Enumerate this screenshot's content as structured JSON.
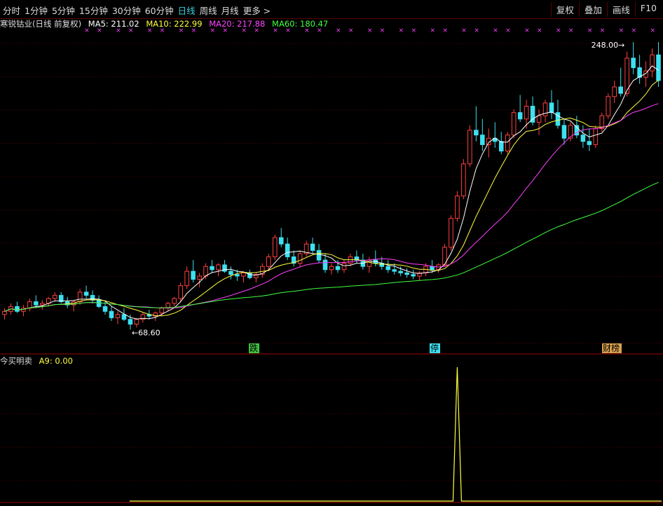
{
  "toolbar": {
    "periods": [
      "分时",
      "1分钟",
      "5分钟",
      "15分钟",
      "30分钟",
      "60分钟",
      "日线",
      "周线",
      "月线",
      "更多 >"
    ],
    "active_period": "日线",
    "right_buttons": [
      "复权",
      "叠加",
      "画线",
      "F10"
    ]
  },
  "info": {
    "stock_name": "寒锐钴业(日线 前复权)",
    "ma5_label": "MA5: 211.02",
    "ma10_label": "MA10: 222.99",
    "ma20_label": "MA20: 217.88",
    "ma60_label": "MA60: 180.47"
  },
  "colors": {
    "up": "#ff4040",
    "down": "#3ce0f0",
    "ma5": "#ffffff",
    "ma10": "#ffff40",
    "ma20": "#ff40ff",
    "ma60": "#40ff40",
    "grid": "#5a0000",
    "indicator": "#ffff40",
    "marker": "#ff40ff"
  },
  "annotations": {
    "high_label": "248.00",
    "low_label": "68.60",
    "event_1": "跌",
    "event_2": "停",
    "event_3": "财榜"
  },
  "indicator": {
    "name": "今买明卖",
    "value_label": "A9: 0.00"
  },
  "chart_data": {
    "type": "candlestick",
    "price_range": [
      60,
      255
    ],
    "candles": [
      [
        78,
        82,
        75,
        80
      ],
      [
        80,
        85,
        78,
        83
      ],
      [
        83,
        86,
        79,
        80
      ],
      [
        80,
        84,
        77,
        82
      ],
      [
        82,
        88,
        80,
        86
      ],
      [
        86,
        90,
        82,
        84
      ],
      [
        84,
        87,
        81,
        85
      ],
      [
        85,
        89,
        83,
        88
      ],
      [
        88,
        92,
        86,
        90
      ],
      [
        90,
        92,
        85,
        86
      ],
      [
        86,
        89,
        82,
        84
      ],
      [
        84,
        87,
        80,
        86
      ],
      [
        86,
        94,
        84,
        92
      ],
      [
        92,
        96,
        88,
        90
      ],
      [
        90,
        93,
        85,
        87
      ],
      [
        87,
        90,
        82,
        83
      ],
      [
        83,
        86,
        78,
        80
      ],
      [
        80,
        83,
        74,
        76
      ],
      [
        76,
        80,
        72,
        78
      ],
      [
        78,
        82,
        74,
        75
      ],
      [
        75,
        78,
        68.6,
        72
      ],
      [
        72,
        76,
        70,
        75
      ],
      [
        75,
        79,
        73,
        78
      ],
      [
        78,
        81,
        75,
        77
      ],
      [
        77,
        80,
        74,
        79
      ],
      [
        79,
        83,
        77,
        82
      ],
      [
        82,
        86,
        80,
        85
      ],
      [
        85,
        89,
        83,
        88
      ],
      [
        88,
        98,
        86,
        96
      ],
      [
        96,
        108,
        94,
        105
      ],
      [
        105,
        112,
        98,
        100
      ],
      [
        100,
        104,
        95,
        102
      ],
      [
        102,
        110,
        100,
        108
      ],
      [
        108,
        112,
        104,
        106
      ],
      [
        106,
        110,
        102,
        109
      ],
      [
        109,
        112,
        104,
        105
      ],
      [
        105,
        108,
        100,
        103
      ],
      [
        103,
        106,
        99,
        102
      ],
      [
        102,
        105,
        98,
        104
      ],
      [
        104,
        106,
        100,
        101
      ],
      [
        101,
        104,
        98,
        103
      ],
      [
        103,
        110,
        101,
        108
      ],
      [
        108,
        116,
        106,
        114
      ],
      [
        114,
        128,
        112,
        126
      ],
      [
        126,
        132,
        120,
        122
      ],
      [
        122,
        126,
        112,
        114
      ],
      [
        114,
        118,
        108,
        110
      ],
      [
        110,
        118,
        108,
        116
      ],
      [
        116,
        124,
        114,
        122
      ],
      [
        122,
        126,
        116,
        118
      ],
      [
        118,
        122,
        110,
        112
      ],
      [
        112,
        116,
        104,
        106
      ],
      [
        106,
        110,
        103,
        108
      ],
      [
        108,
        112,
        104,
        106
      ],
      [
        106,
        112,
        104,
        110
      ],
      [
        110,
        116,
        108,
        114
      ],
      [
        114,
        118,
        110,
        112
      ],
      [
        112,
        116,
        106,
        108
      ],
      [
        108,
        114,
        104,
        112
      ],
      [
        112,
        118,
        108,
        110
      ],
      [
        110,
        114,
        106,
        108
      ],
      [
        108,
        112,
        104,
        106
      ],
      [
        106,
        110,
        103,
        105
      ],
      [
        105,
        108,
        102,
        104
      ],
      [
        104,
        107,
        101,
        103
      ],
      [
        103,
        106,
        100,
        102
      ],
      [
        102,
        105,
        99,
        104
      ],
      [
        104,
        110,
        102,
        108
      ],
      [
        108,
        112,
        104,
        106
      ],
      [
        106,
        110,
        104,
        109
      ],
      [
        109,
        122,
        108,
        120
      ],
      [
        120,
        140,
        118,
        138
      ],
      [
        138,
        155,
        136,
        152
      ],
      [
        152,
        175,
        150,
        172
      ],
      [
        172,
        196,
        170,
        193
      ],
      [
        193,
        208,
        186,
        190
      ],
      [
        190,
        200,
        180,
        184
      ],
      [
        184,
        194,
        176,
        188
      ],
      [
        188,
        198,
        182,
        186
      ],
      [
        186,
        192,
        178,
        180
      ],
      [
        180,
        192,
        178,
        190
      ],
      [
        190,
        206,
        188,
        204
      ],
      [
        204,
        215,
        198,
        200
      ],
      [
        200,
        212,
        194,
        208
      ],
      [
        208,
        214,
        196,
        198
      ],
      [
        198,
        206,
        190,
        202
      ],
      [
        202,
        212,
        198,
        210
      ],
      [
        210,
        218,
        200,
        204
      ],
      [
        204,
        212,
        194,
        196
      ],
      [
        196,
        200,
        184,
        188
      ],
      [
        188,
        198,
        186,
        196
      ],
      [
        196,
        202,
        188,
        190
      ],
      [
        190,
        196,
        182,
        186
      ],
      [
        186,
        194,
        180,
        184
      ],
      [
        184,
        196,
        182,
        194
      ],
      [
        194,
        204,
        192,
        202
      ],
      [
        202,
        216,
        200,
        214
      ],
      [
        214,
        224,
        210,
        220
      ],
      [
        220,
        232,
        214,
        216
      ],
      [
        216,
        242,
        214,
        238
      ],
      [
        238,
        248,
        228,
        232
      ],
      [
        232,
        240,
        222,
        226
      ],
      [
        226,
        236,
        220,
        230
      ],
      [
        230,
        244,
        226,
        240
      ],
      [
        240,
        248,
        220,
        224
      ]
    ],
    "indicator_values_spike": {
      "index": 72,
      "value": 1
    }
  }
}
